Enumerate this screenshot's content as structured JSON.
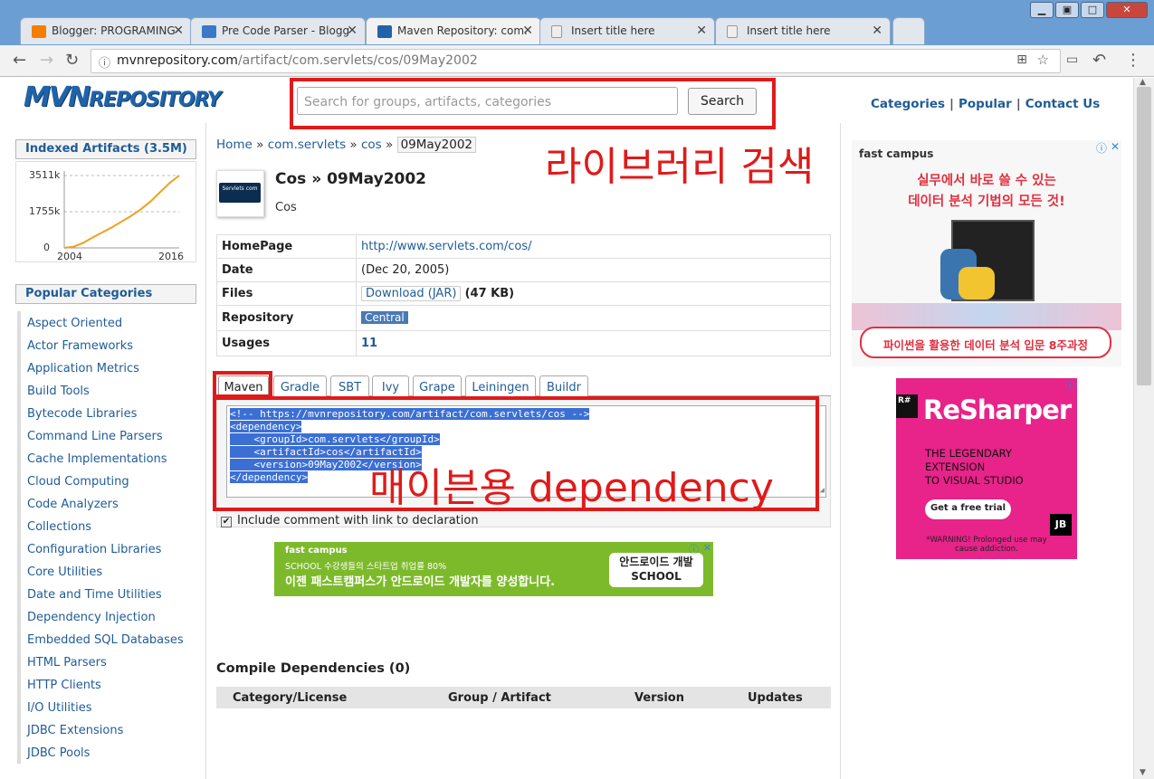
{
  "browser": {
    "tabs": [
      {
        "label": "Blogger: PROGRAMING",
        "icon": "blogger-icon",
        "color": "#f57d00"
      },
      {
        "label": "Pre Code Parser - Blogg",
        "icon": "code-parser-icon",
        "color": "#3a78c8"
      },
      {
        "label": "Maven Repository: com.",
        "icon": "mvn-icon",
        "color": "#2163a8"
      },
      {
        "label": "Insert title here",
        "icon": "page-icon",
        "color": "#cccccc"
      },
      {
        "label": "Insert title here",
        "icon": "page-icon",
        "color": "#cccccc"
      }
    ],
    "url_host": "mvnrepository.com",
    "url_path": "/artifact/com.servlets/cos/09May2002"
  },
  "header": {
    "logo_main": "MVN",
    "logo_sub": "REPOSITORY",
    "search_placeholder": "Search for groups, artifacts, categories",
    "search_button": "Search",
    "nav": [
      "Categories",
      "Popular",
      "Contact Us"
    ]
  },
  "annotations": {
    "search_note": "라이브러리 검색",
    "dependency_note": "매이븐용 dependency"
  },
  "sidebar": {
    "indexed_title": "Indexed Artifacts (3.5M)",
    "popular_title": "Popular Categories",
    "categories": [
      "Aspect Oriented",
      "Actor Frameworks",
      "Application Metrics",
      "Build Tools",
      "Bytecode Libraries",
      "Command Line Parsers",
      "Cache Implementations",
      "Cloud Computing",
      "Code Analyzers",
      "Collections",
      "Configuration Libraries",
      "Core Utilities",
      "Date and Time Utilities",
      "Dependency Injection",
      "Embedded SQL Databases",
      "HTML Parsers",
      "HTTP Clients",
      "I/O Utilities",
      "JDBC Extensions",
      "JDBC Pools"
    ]
  },
  "chart_data": {
    "type": "line",
    "x": [
      2004,
      2005,
      2006,
      2007,
      2008,
      2009,
      2010,
      2011,
      2012,
      2013,
      2014,
      2015,
      2016
    ],
    "values": [
      0,
      60,
      250,
      520,
      760,
      1000,
      1280,
      1560,
      1880,
      2250,
      2700,
      3150,
      3511
    ],
    "xticks": [
      "2004",
      "2016"
    ],
    "yticks": [
      "3511k",
      "1755k",
      "0"
    ],
    "ylim": [
      0,
      3511
    ],
    "color": "#f0a020"
  },
  "breadcrumb": {
    "items": [
      "Home",
      "com.servlets",
      "cos"
    ],
    "current": "09May2002",
    "separator": "»"
  },
  "artifact": {
    "title": "Cos » 09May2002",
    "subtitle": "Cos",
    "logo_text": "Servlets com",
    "rows": {
      "homepage_label": "HomePage",
      "homepage": "http://www.servlets.com/cos/",
      "date_label": "Date",
      "date": "(Dec 20, 2005)",
      "files_label": "Files",
      "files_button": "Download (JAR)",
      "files_size": "(47 KB)",
      "repository_label": "Repository",
      "repository": "Central",
      "usages_label": "Usages",
      "usages": "11"
    }
  },
  "dependency_tabs": [
    "Maven",
    "Gradle",
    "SBT",
    "Ivy",
    "Grape",
    "Leiningen",
    "Buildr"
  ],
  "code_lines": [
    "<!-- https://mvnrepository.com/artifact/com.servlets/cos -->",
    "<dependency>",
    "    <groupId>com.servlets</groupId>",
    "    <artifactId>cos</artifactId>",
    "    <version>09May2002</version>",
    "</dependency>"
  ],
  "include_comment_label": "Include comment with link to declaration",
  "ads": {
    "green_brand": "fast campus",
    "green_line1": "SCHOOL 수강생들의 스타트업 취업률 80%",
    "green_line2": "이젠 패스트캠퍼스가 안드로이드 개발자를 양성합니다.",
    "green_badge1": "안드로이드 개발",
    "green_badge2": "SCHOOL",
    "right1_brand": "fast campus",
    "right1_line1": "실무에서 바로 쓸 수 있는",
    "right1_line2": "데이터 분석 기법의 모든 것!",
    "right1_cta": "파이썬을 활용한 데이터 분석 입문 8주과정",
    "right2_title": "ReSharper",
    "right2_line1": "THE LEGENDARY",
    "right2_line2": "EXTENSION",
    "right2_line3": "TO VISUAL STUDIO",
    "right2_cta": "Get a free trial",
    "right2_warning": "*WARNING! Prolonged use may cause addiction."
  },
  "compile": {
    "title": "Compile Dependencies (0)",
    "headers": [
      "Category/License",
      "Group / Artifact",
      "Version",
      "Updates"
    ]
  }
}
